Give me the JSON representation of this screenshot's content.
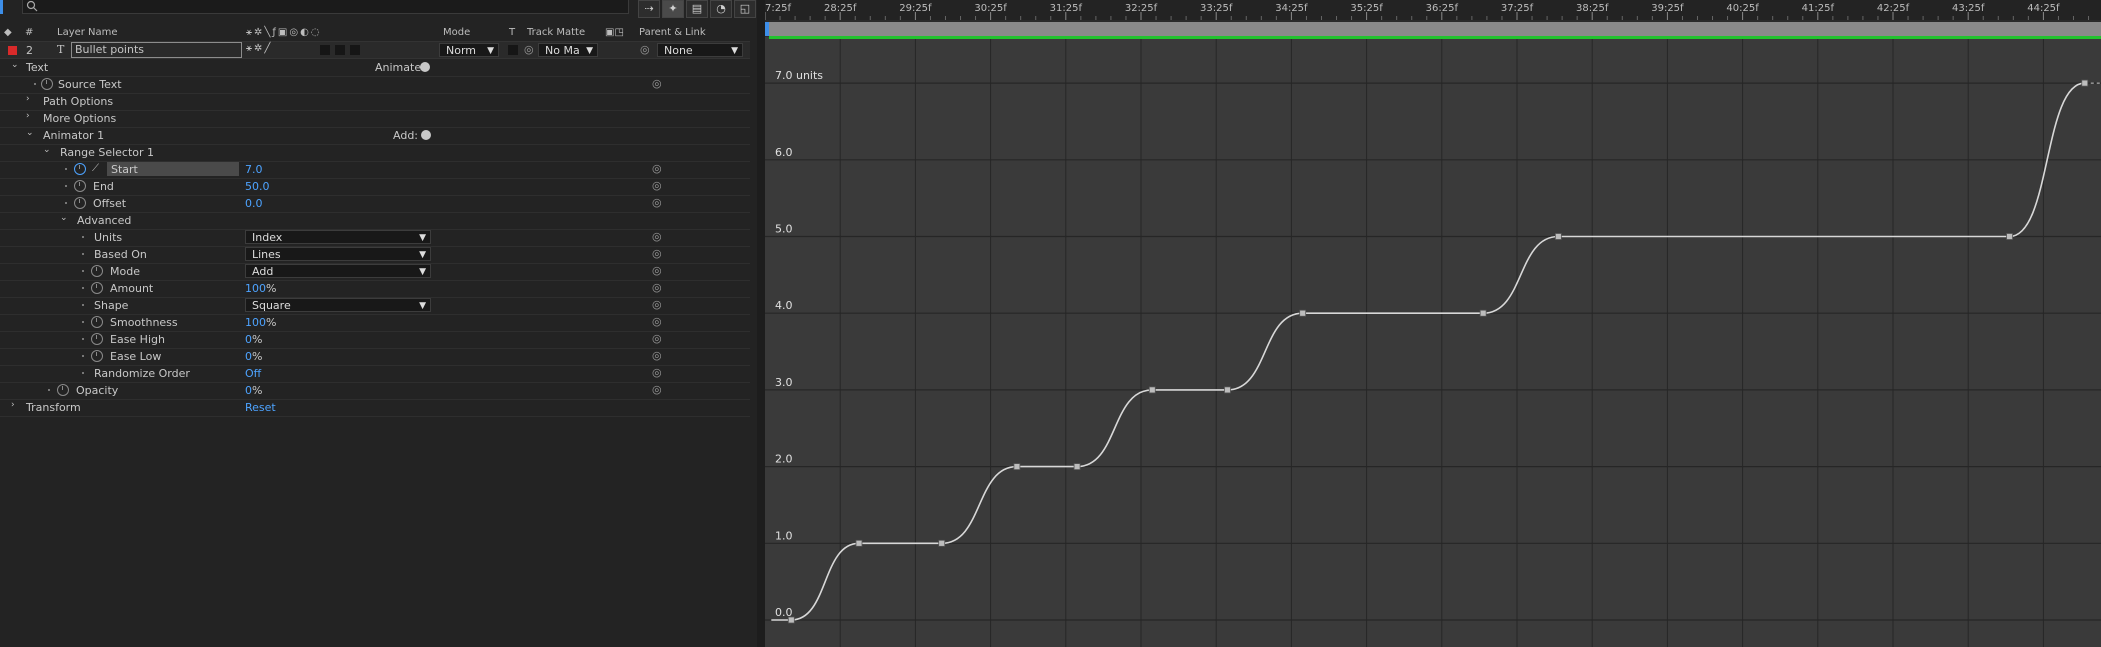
{
  "toolbar": {
    "search_icon": "search-icon",
    "buttons": [
      "graph-editor-toggle-icon",
      "new-comp-icon",
      "solo-icon",
      "motion-blur-icon",
      "graph-editor-icon"
    ]
  },
  "columns": {
    "num": "#",
    "layer_name": "Layer Name",
    "mode": "Mode",
    "t": "T",
    "track_matte": "Track Matte",
    "parent": "Parent & Link"
  },
  "layer": {
    "index": "2",
    "type_glyph": "T",
    "name": "Bullet points",
    "label_color": "#d92a2a",
    "mode": "Norm",
    "track_matte": "No Ma",
    "parent": "None"
  },
  "tree": {
    "text": "Text",
    "animate_label": "Animate:",
    "source_text": "Source Text",
    "path_options": "Path Options",
    "more_options": "More Options",
    "animator": "Animator 1",
    "add_label": "Add:",
    "range_selector": "Range Selector 1",
    "start_label": "Start",
    "start_value": "7.0",
    "end_label": "End",
    "end_value": "50.0",
    "offset_label": "Offset",
    "offset_value": "0.0",
    "advanced": "Advanced",
    "units_label": "Units",
    "units_value": "Index",
    "based_on_label": "Based On",
    "based_on_value": "Lines",
    "mode_label": "Mode",
    "mode_value": "Add",
    "amount_label": "Amount",
    "amount_value": "100",
    "shape_label": "Shape",
    "shape_value": "Square",
    "smoothness_label": "Smoothness",
    "smoothness_value": "100",
    "ease_high_label": "Ease High",
    "ease_high_value": "0",
    "ease_low_label": "Ease Low",
    "ease_low_value": "0",
    "randomize_label": "Randomize Order",
    "randomize_value": "Off",
    "opacity_label": "Opacity",
    "opacity_value": "0",
    "pct": "%",
    "transform": "Transform",
    "reset": "Reset"
  },
  "graph": {
    "time_labels": [
      "7:25f",
      "28:25f",
      "29:25f",
      "30:25f",
      "31:25f",
      "32:25f",
      "33:25f",
      "34:25f",
      "35:25f",
      "36:25f",
      "37:25f",
      "38:25f",
      "39:25f",
      "40:25f",
      "41:25f",
      "42:25f",
      "43:25f",
      "44:25f"
    ],
    "value_labels": [
      "7.0 units",
      "6.0",
      "5.0",
      "4.0",
      "3.0",
      "2.0",
      "1.0",
      "0.0"
    ],
    "keyframes": [
      {
        "t": 27.6,
        "v": 0
      },
      {
        "t": 28.5,
        "v": 1
      },
      {
        "t": 29.6,
        "v": 1
      },
      {
        "t": 30.6,
        "v": 2
      },
      {
        "t": 31.4,
        "v": 2
      },
      {
        "t": 32.4,
        "v": 3
      },
      {
        "t": 33.4,
        "v": 3
      },
      {
        "t": 34.4,
        "v": 4
      },
      {
        "t": 36.8,
        "v": 4
      },
      {
        "t": 37.8,
        "v": 5
      },
      {
        "t": 43.8,
        "v": 5
      },
      {
        "t": 44.8,
        "v": 7
      }
    ],
    "colors": {
      "background": "#3a3a3a",
      "grid": "#262626",
      "curve": "#d8d8d8",
      "work_area": "#8a8a8a",
      "work_area_line": "#22c32e",
      "playhead": "#3d8ee8"
    }
  }
}
